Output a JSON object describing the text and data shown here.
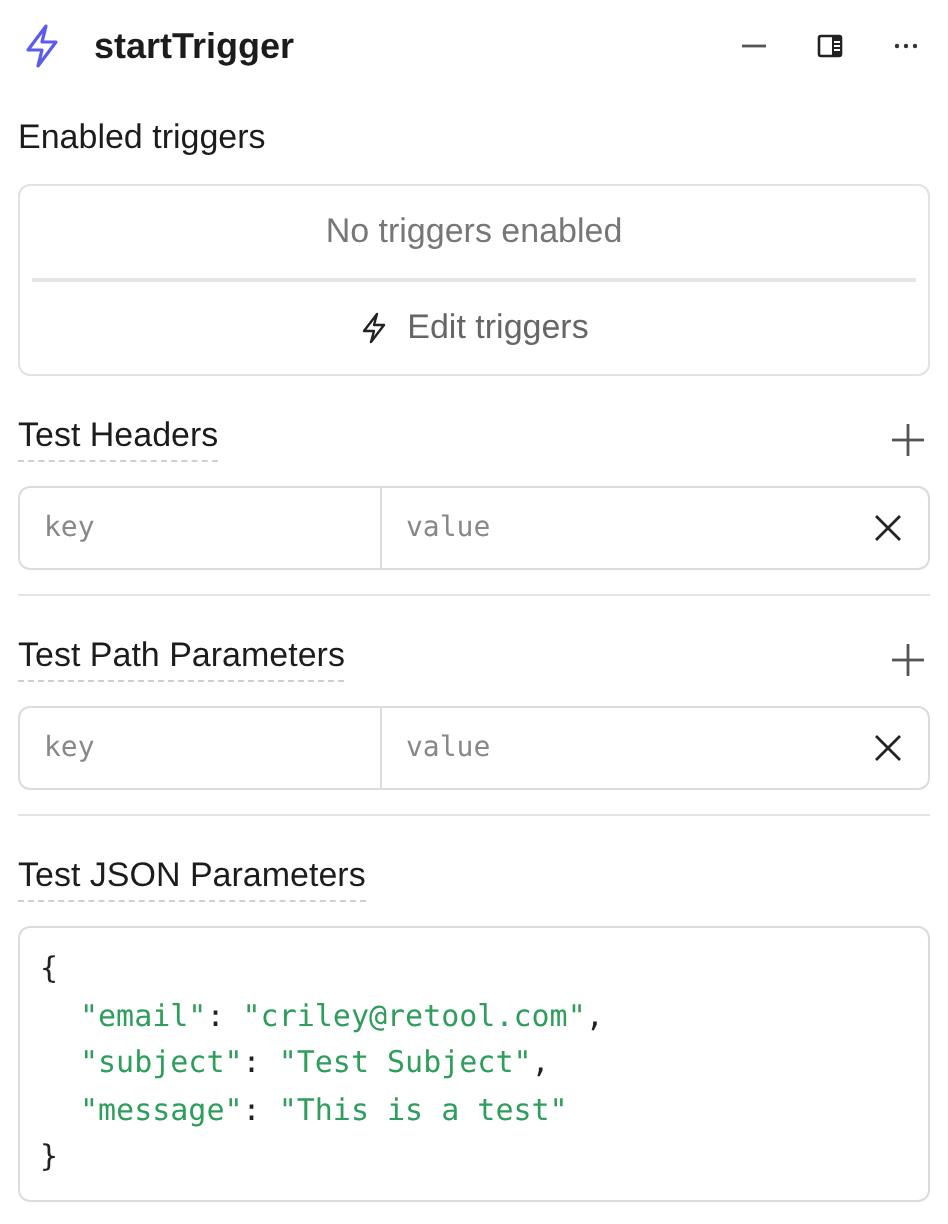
{
  "panel": {
    "title": "startTrigger"
  },
  "enabled_triggers": {
    "heading": "Enabled triggers",
    "empty_text": "No triggers enabled",
    "edit_button": "Edit triggers"
  },
  "param_sections": [
    {
      "heading": "Test Headers",
      "rows": [
        {
          "key_placeholder": "key",
          "value_placeholder": "value"
        }
      ]
    },
    {
      "heading": "Test Path Parameters",
      "rows": [
        {
          "key_placeholder": "key",
          "value_placeholder": "value"
        }
      ]
    }
  ],
  "json_params": {
    "heading": "Test JSON Parameters",
    "lines": [
      {
        "kind": "punct",
        "text": "{"
      },
      {
        "kind": "entry",
        "key": "\"email\"",
        "sep": ": ",
        "value": "\"criley@retool.com\"",
        "trail": ","
      },
      {
        "kind": "entry",
        "key": "\"subject\"",
        "sep": ": ",
        "value": "\"Test Subject\"",
        "trail": ","
      },
      {
        "kind": "entry",
        "key": "\"message\"",
        "sep": ": ",
        "value": "\"This is a test\""
      },
      {
        "kind": "punct",
        "text": "}"
      }
    ]
  }
}
